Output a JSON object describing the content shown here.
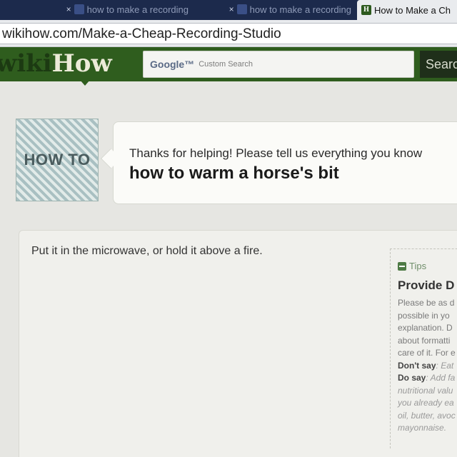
{
  "browser": {
    "tabs": [
      {
        "label": "how to make a recording",
        "active": false
      },
      {
        "label": "how to make a recording",
        "active": false
      },
      {
        "label": "How to Make a Ch",
        "active": true,
        "favicon": "H"
      }
    ],
    "close_glyph": "×",
    "url": "wikihow.com/Make-a-Cheap-Recording-Studio"
  },
  "header": {
    "logo_wiki": "wiki",
    "logo_how": "How",
    "search_brand": "Google™",
    "search_placeholder": "Custom Search",
    "search_button": "Searc"
  },
  "question_section": {
    "badge": "HOW TO",
    "prompt": "Thanks for helping! Please tell us everything you know",
    "question": "how to warm a horse's bit"
  },
  "answer": {
    "text": "Put it in the microwave, or hold it above a fire."
  },
  "tips": {
    "heading": "Tips",
    "title": "Provide D",
    "lines": [
      "Please be as d",
      "possible in yo",
      "explanation. D",
      "about formatti",
      "care of it. For e"
    ],
    "dont_label": "Don't say",
    "dont_text": ": Eat",
    "do_label": "Do say",
    "do_text": ": Add fa",
    "italic_lines": [
      "nutritional valu",
      "you already ea",
      "oil, butter, avoc",
      "mayonnaise."
    ]
  },
  "colors": {
    "header_green": "#2f5d1e",
    "tab_bar": "#1c2a4c"
  }
}
